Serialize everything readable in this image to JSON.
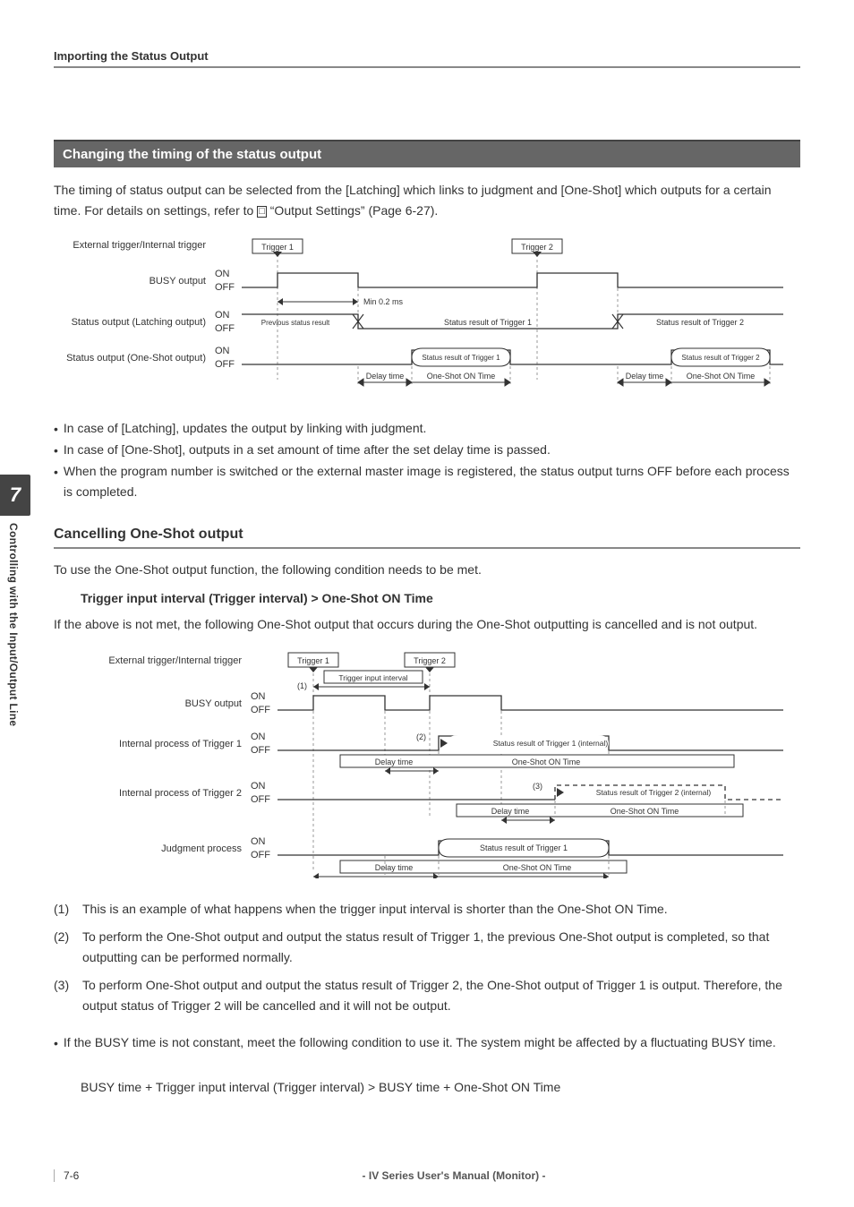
{
  "header": {
    "title": "Importing the Status Output"
  },
  "side_tab": {
    "chapter": "7",
    "label": "Controlling with the Input/Output Line"
  },
  "section1": {
    "title": "Changing the timing of the status output",
    "intro_a": "The timing of status output can be selected from the [Latching] which links to judgment and [One-Shot] which outputs for a certain time. For details on settings, refer to ",
    "intro_ref": " “Output Settings” (Page 6-27).",
    "bullets": [
      "In case of [Latching], updates the output by linking with judgment.",
      "In case of [One-Shot], outputs in a set amount of time after the set delay time is passed.",
      "When the program number is switched or the external master image is registered, the status output turns OFF before each process is completed."
    ]
  },
  "section2": {
    "title": "Cancelling One-Shot output",
    "p1": "To use the One-Shot output function, the following condition needs to be met.",
    "cond": "Trigger input interval (Trigger interval) > One-Shot ON Time",
    "p2": "If the above is not met, the following One-Shot output that occurs during the One-Shot outputting is cancelled and is not output.",
    "numbered": [
      {
        "n": "(1)",
        "t": "This is an example of what happens when the trigger input interval is shorter than the One-Shot ON Time."
      },
      {
        "n": "(2)",
        "t": "To perform the One-Shot output and output the status result of Trigger 1, the previous One-Shot output is completed, so that outputting can be performed normally."
      },
      {
        "n": "(3)",
        "t": "To perform One-Shot output and output the status result of Trigger 2, the One-Shot output of Trigger 1 is output. Therefore, the output status of Trigger 2 will be cancelled and it will not be output."
      }
    ],
    "busy_note": "If the BUSY time is not constant, meet the following condition to use it. The system might be affected by a fluctuating BUSY time.",
    "busy_cond": "BUSY time + Trigger input interval (Trigger interval) > BUSY time + One-Shot ON Time"
  },
  "diagram1": {
    "rows": {
      "ext": "External trigger/Internal trigger",
      "busy": "BUSY output",
      "latch": "Status output (Latching output)",
      "oneshot": "Status output (One-Shot output)"
    },
    "on": "ON",
    "off": "OFF",
    "trigger1": "Trigger 1",
    "trigger2": "Trigger 2",
    "min": "Min 0.2 ms",
    "prev": "Previous status result",
    "sr1": "Status result of Trigger 1",
    "sr2": "Status result of Trigger 2",
    "sr1_bubble": "Status result of Trigger 1",
    "sr2_bubble": "Status result of Trigger 2",
    "delay": "Delay time",
    "on_time": "One-Shot ON Time"
  },
  "diagram2": {
    "rows": {
      "ext": "External trigger/Internal trigger",
      "busy": "BUSY output",
      "ip1": "Internal process of Trigger 1",
      "ip2": "Internal process of Trigger 2",
      "judge": "Judgment process"
    },
    "on": "ON",
    "off": "OFF",
    "trigger1": "Trigger 1",
    "trigger2": "Trigger 2",
    "tii": "Trigger input interval",
    "n1": "(1)",
    "n2": "(2)",
    "n3": "(3)",
    "sr1i": "Status result of Trigger 1 (internal)",
    "sr2i": "Status result of Trigger 2 (internal)",
    "sr1": "Status result of Trigger 1",
    "delay": "Delay time",
    "on_time": "One-Shot ON Time"
  },
  "footer": {
    "page": "7-6",
    "title": "- IV Series User's Manual (Monitor) -"
  },
  "chart_data": [
    {
      "type": "timing-diagram",
      "title": "Status output timing (Latching vs One-Shot)",
      "signals": [
        {
          "name": "External trigger/Internal trigger",
          "events": [
            "Trigger 1 pulse",
            "Trigger 2 pulse"
          ]
        },
        {
          "name": "BUSY output",
          "states": [
            "ON after Trigger 1 (>=0.2 ms)",
            "OFF",
            "ON after Trigger 2",
            "OFF"
          ]
        },
        {
          "name": "Status output (Latching output)",
          "segments": [
            "Previous status result (ON)",
            "Status result of Trigger 1 (OFF)",
            "Status result of Trigger 2 (ON)"
          ]
        },
        {
          "name": "Status output (One-Shot output)",
          "segments": [
            "OFF",
            "Delay time then Status result of Trigger 1 for One-Shot ON Time",
            "OFF",
            "Delay time then Status result of Trigger 2 for One-Shot ON Time"
          ]
        }
      ],
      "annotations": [
        "Min 0.2 ms",
        "Delay time",
        "One-Shot ON Time"
      ]
    },
    {
      "type": "timing-diagram",
      "title": "Cancelling One-Shot output when Trigger interval < One-Shot ON Time",
      "signals": [
        {
          "name": "External trigger/Internal trigger",
          "events": [
            "Trigger 1 pulse",
            "Trigger 2 pulse"
          ],
          "note": "(1) Trigger input interval"
        },
        {
          "name": "BUSY output",
          "states": [
            "ON after Trigger 1",
            "OFF",
            "ON after Trigger 2",
            "OFF"
          ]
        },
        {
          "name": "Internal process of Trigger 1",
          "segments": [
            "OFF",
            "(2) Delay time then Status result of Trigger 1 (internal) for One-Shot ON Time",
            "OFF"
          ]
        },
        {
          "name": "Internal process of Trigger 2",
          "segments": [
            "OFF",
            "(3) Delay time then Status result of Trigger 2 (internal) for One-Shot ON Time (cancelled, dashed)",
            "OFF"
          ]
        },
        {
          "name": "Judgment process",
          "segments": [
            "OFF",
            "Delay time then Status result of Trigger 1 for One-Shot ON Time",
            "OFF"
          ]
        }
      ],
      "annotations": [
        "Trigger input interval",
        "Delay time",
        "One-Shot ON Time"
      ]
    }
  ]
}
